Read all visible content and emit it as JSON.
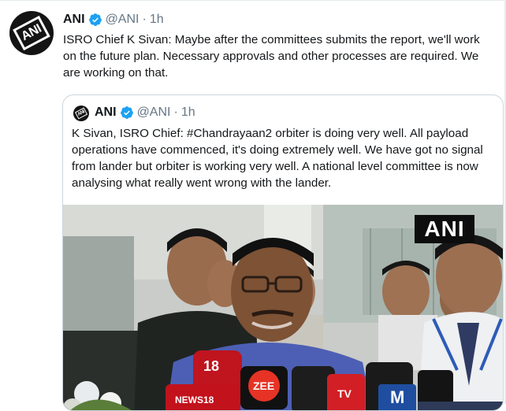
{
  "tweet": {
    "author_name": "ANI",
    "handle": "@ANI",
    "separator": "·",
    "time": "1h",
    "text": "ISRO Chief K Sivan: Maybe after the committees submits the report, we'll work on the future plan. Necessary approvals and other processes are required. We are working on that.",
    "avatar_logo": "ANI"
  },
  "quoted_tweet": {
    "author_name": "ANI",
    "handle": "@ANI",
    "separator": "·",
    "time": "1h",
    "text": "K Sivan, ISRO Chief: #Chandrayaan2 orbiter is doing very well. All payload operations have commenced, it's doing extremely well. We have got no signal from lander but orbiter is working very well. A national level committee is now analysing what really went wrong with the lander.",
    "avatar_logo": "ANI"
  },
  "media": {
    "watermark": "ANI",
    "mic_labels": {
      "news18_top": "18",
      "news18_bottom": "NEWS18",
      "zee": "ZEE",
      "tv": "TV",
      "mathrubhumi": "M"
    }
  },
  "colors": {
    "verified_blue": "#1da1f2",
    "muted_text": "#657786",
    "border": "#ccd6dd"
  },
  "icons": [
    "verified-badge-icon"
  ]
}
